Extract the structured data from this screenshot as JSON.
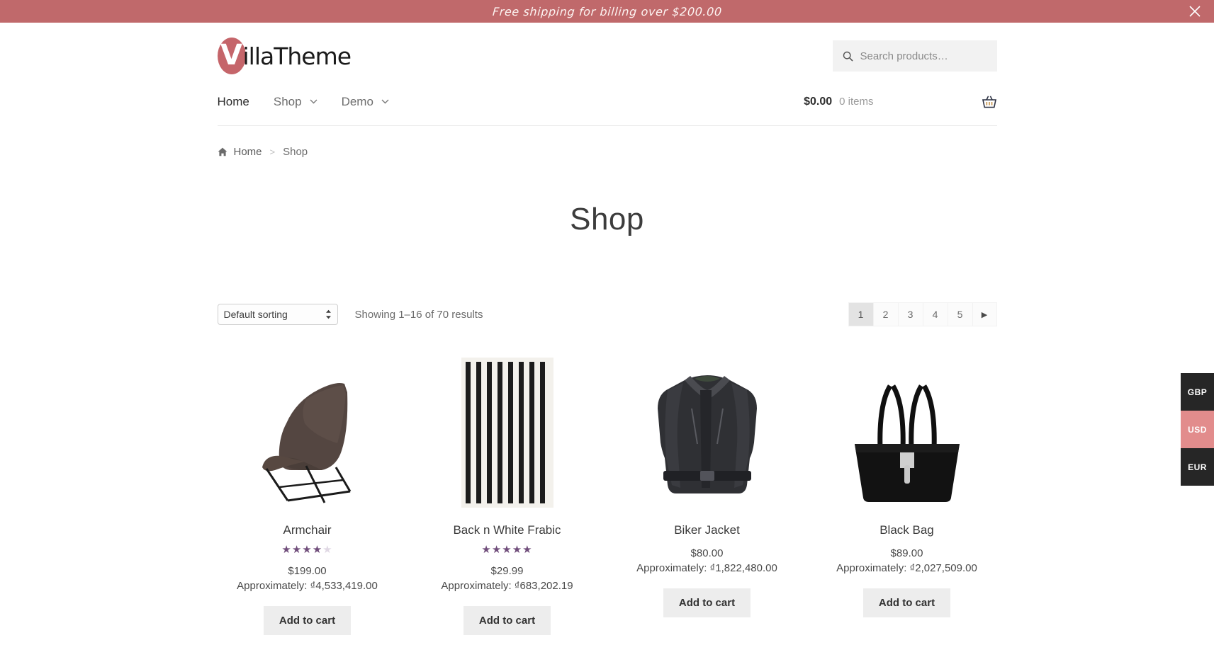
{
  "promo": {
    "text": "Free shipping for billing over $200.00",
    "close_label": "close-banner",
    "bg_color": "#c0696b"
  },
  "header": {
    "logo_initial": "V",
    "logo_text": "illaTheme",
    "search": {
      "placeholder": "Search products…"
    },
    "nav": [
      {
        "label": "Home",
        "has_dropdown": false,
        "active": true
      },
      {
        "label": "Shop",
        "has_dropdown": true,
        "active": false
      },
      {
        "label": "Demo",
        "has_dropdown": true,
        "active": false
      }
    ],
    "cart": {
      "total": "$0.00",
      "count": "0 items",
      "icon": "basket-icon"
    }
  },
  "breadcrumb": {
    "home": "Home",
    "separator": ">",
    "current": "Shop"
  },
  "page": {
    "title": "Shop"
  },
  "toolbar": {
    "sorting_selected": "Default sorting",
    "sorting_options": [
      "Default sorting"
    ],
    "result_count": "Showing 1–16 of 70 results",
    "pagination": {
      "pages": [
        "1",
        "2",
        "3",
        "4",
        "5"
      ],
      "current": "1",
      "next_label": "▶"
    }
  },
  "products": [
    {
      "name": "Armchair",
      "rating": 4,
      "rating_max": 5,
      "has_rating": true,
      "price": "$199.00",
      "approx": "Approximately: ₫4,533,419.00",
      "add_to_cart": "Add to cart",
      "image": "armchair"
    },
    {
      "name": "Back n White Frabic",
      "rating": 5,
      "rating_max": 5,
      "has_rating": true,
      "price": "$29.99",
      "approx": "Approximately: ₫683,202.19",
      "add_to_cart": "Add to cart",
      "image": "striped-fabric"
    },
    {
      "name": "Biker Jacket",
      "rating": 0,
      "rating_max": 5,
      "has_rating": false,
      "price": "$80.00",
      "approx": "Approximately: ₫1,822,480.00",
      "add_to_cart": "Add to cart",
      "image": "biker-jacket"
    },
    {
      "name": "Black Bag",
      "rating": 0,
      "rating_max": 5,
      "has_rating": false,
      "price": "$89.00",
      "approx": "Approximately: ₫2,027,509.00",
      "add_to_cart": "Add to cart",
      "image": "black-bag"
    }
  ],
  "currency_switcher": {
    "items": [
      {
        "code": "GBP",
        "active": false
      },
      {
        "code": "USD",
        "active": true
      },
      {
        "code": "EUR",
        "active": false
      }
    ],
    "active_color": "#e28c8c",
    "inactive_color": "#262626"
  }
}
